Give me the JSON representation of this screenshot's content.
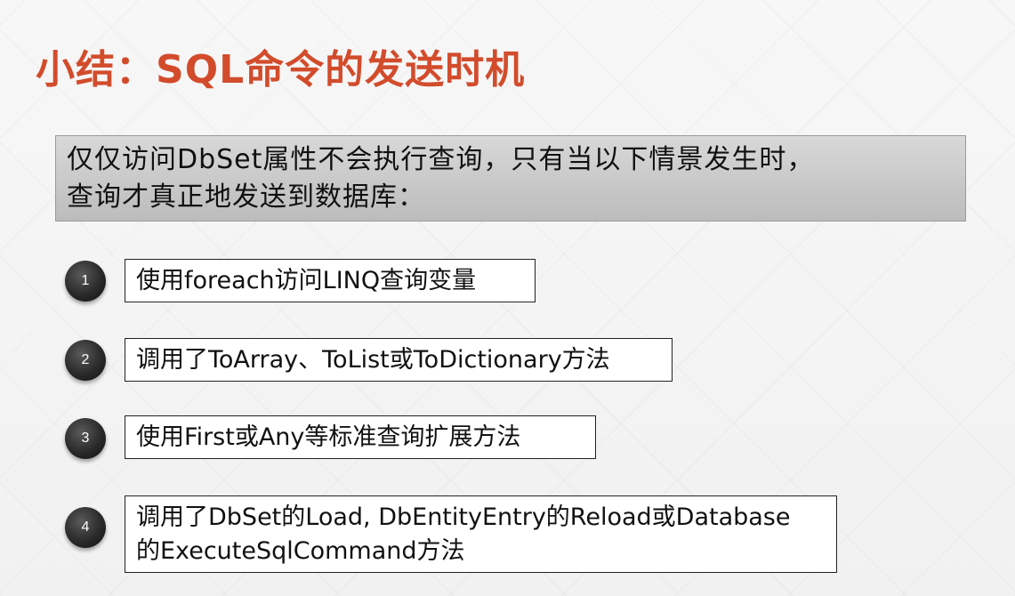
{
  "title": "小结：SQL命令的发送时机",
  "intro": {
    "line1": "仅仅访问DbSet属性不会执行查询，只有当以下情景发生时，",
    "line2": "查询才真正地发送到数据库："
  },
  "items": [
    {
      "number": "1",
      "text": "使用foreach访问LINQ查询变量"
    },
    {
      "number": "2",
      "text": "调用了ToArray、ToList或ToDictionary方法"
    },
    {
      "number": "3",
      "text": "使用First或Any等标准查询扩展方法"
    },
    {
      "number": "4",
      "line1": "调用了DbSet的Load, DbEntityEntry的Reload或Database",
      "line2": "的ExecuteSqlCommand方法"
    }
  ],
  "colors": {
    "title": "#d24c2c",
    "intro_bg": "#cccccc",
    "bullet": "#2a2a2a"
  }
}
